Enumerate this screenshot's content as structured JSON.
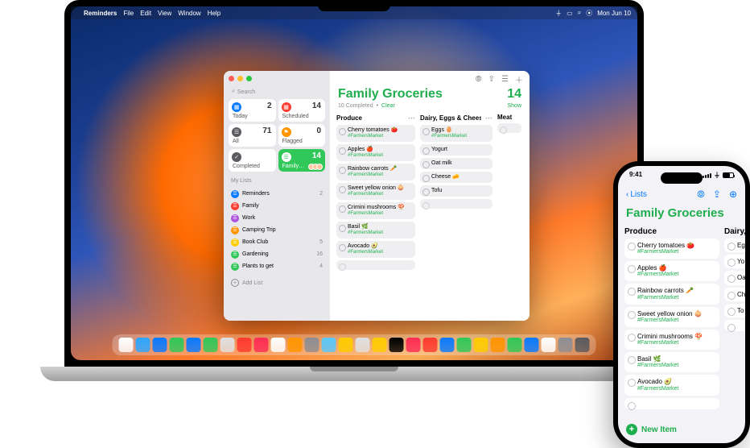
{
  "menubar": {
    "app": "Reminders",
    "items": [
      "File",
      "Edit",
      "View",
      "Window",
      "Help"
    ],
    "clock": "Mon Jun 10"
  },
  "window": {
    "search_placeholder": "Search",
    "smart": {
      "today": {
        "label": "Today",
        "count": 2,
        "color": "#0a7aff"
      },
      "scheduled": {
        "label": "Scheduled",
        "count": 14,
        "color": "#ff3b30"
      },
      "all": {
        "label": "All",
        "count": 71,
        "color": "#5b5b60"
      },
      "flagged": {
        "label": "Flagged",
        "count": 0,
        "color": "#ff9500"
      },
      "completed": {
        "label": "Completed",
        "count": "",
        "color": "#5b5b60"
      },
      "family": {
        "label": "Family…",
        "count": 14,
        "color": "#31c859"
      }
    },
    "mylists_header": "My Lists",
    "lists": [
      {
        "label": "Reminders",
        "count": 2,
        "color": "#0a7aff"
      },
      {
        "label": "Family",
        "count": "",
        "color": "#ff3b30"
      },
      {
        "label": "Work",
        "count": "",
        "color": "#af52de"
      },
      {
        "label": "Camping Trip",
        "count": "",
        "color": "#ff9500"
      },
      {
        "label": "Book Club",
        "count": 5,
        "color": "#ffcc00"
      },
      {
        "label": "Gardening",
        "count": 16,
        "color": "#31c859"
      },
      {
        "label": "Plants to get",
        "count": 4,
        "color": "#31c859"
      }
    ],
    "add_list": "Add List",
    "title": "Family Groceries",
    "big_count": "14",
    "completed_text": "10 Completed",
    "clear": "Clear",
    "show": "Show",
    "columns": {
      "produce": {
        "header": "Produce",
        "items": [
          {
            "t": "Cherry tomatoes 🍅",
            "tag": "#FarmersMarket"
          },
          {
            "t": "Apples 🍎",
            "tag": "#FarmersMarket"
          },
          {
            "t": "Rainbow carrots 🥕",
            "tag": "#FarmersMarket"
          },
          {
            "t": "Sweet yellow onion 🧅",
            "tag": "#FarmersMarket"
          },
          {
            "t": "Crimini mushrooms 🍄",
            "tag": "#FarmersMarket"
          },
          {
            "t": "Basil 🌿",
            "tag": "#FarmersMarket"
          },
          {
            "t": "Avocado 🥑",
            "tag": "#FarmersMarket"
          }
        ]
      },
      "dairy": {
        "header": "Dairy, Eggs & Cheese",
        "items": [
          {
            "t": "Eggs 🥚",
            "tag": "#FarmersMarket"
          },
          {
            "t": "Yogurt"
          },
          {
            "t": "Oat milk"
          },
          {
            "t": "Cheese 🧀"
          },
          {
            "t": "Tofu"
          }
        ]
      },
      "meat": {
        "header": "Meat"
      }
    }
  },
  "iphone": {
    "time": "9:41",
    "back": "Lists",
    "title": "Family Groceries",
    "columns": {
      "produce": {
        "header": "Produce",
        "items": [
          {
            "t": "Cherry tomatoes 🍅",
            "tag": "#FarmersMarket"
          },
          {
            "t": "Apples 🍎",
            "tag": "#FarmersMarket"
          },
          {
            "t": "Rainbow carrots 🥕",
            "tag": "#FarmersMarket"
          },
          {
            "t": "Sweet yellow onion 🧅",
            "tag": "#FarmersMarket"
          },
          {
            "t": "Crimini mushrooms 🍄",
            "tag": "#FarmersMarket"
          },
          {
            "t": "Basil 🌿",
            "tag": "#FarmersMarket"
          },
          {
            "t": "Avocado 🥑",
            "tag": "#FarmersMarket"
          }
        ]
      },
      "dairy": {
        "header": "Dairy,",
        "items": [
          {
            "t": "Egg"
          },
          {
            "t": "Yo"
          },
          {
            "t": "Oa"
          },
          {
            "t": "Ch"
          },
          {
            "t": "To"
          }
        ]
      }
    },
    "new_item": "New Item"
  },
  "dock_colors": [
    "#ffffff",
    "#2ea7ff",
    "#0a7aff",
    "#31c859",
    "#0a7aff",
    "#31c859",
    "#e0e0e0",
    "#ff3b30",
    "#ff2d55",
    "#ffffff",
    "#ff9500",
    "#8e8e93",
    "#5ac8fa",
    "#ffcc00",
    "#e0e0e0",
    "#ffcc00",
    "#000000",
    "#ff2d55",
    "#ff3b30",
    "#0a7aff",
    "#31c859",
    "#ffcc00",
    "#ff9500",
    "#31c859",
    "#0a7aff",
    "#ffffff",
    "#8e8e93",
    "#5b5b60"
  ]
}
